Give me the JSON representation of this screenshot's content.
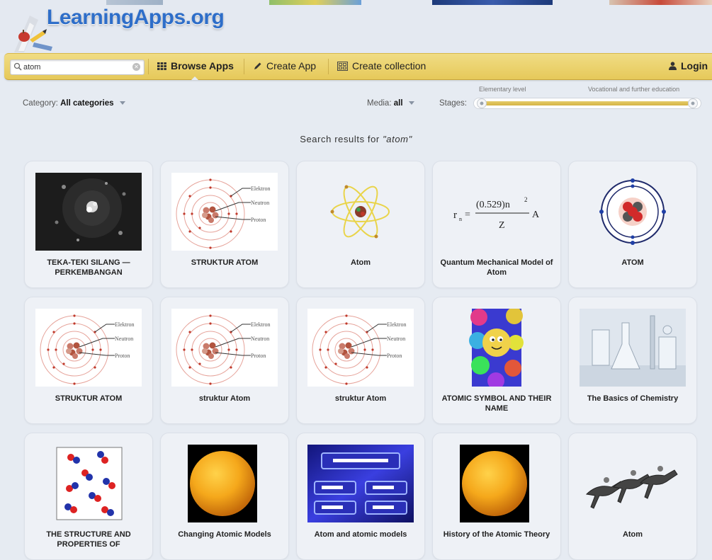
{
  "header": {
    "logo_text": "LearningApps.org"
  },
  "nav": {
    "search": {
      "value": "atom",
      "placeholder": ""
    },
    "browse_label": "Browse Apps",
    "create_app_label": "Create App",
    "create_collection_label": "Create collection",
    "login_label": "Login"
  },
  "filters": {
    "category_label": "Category:",
    "category_value": "All categories",
    "media_label": "Media:",
    "media_value": "all",
    "stages_label": "Stages:",
    "stage_left": "Elementary level",
    "stage_right": "Vocational and further education"
  },
  "results": {
    "prefix": "Search results for ",
    "query": "\"atom\"",
    "items": [
      {
        "title": "TEKA-TEKI SILANG — PERKEMBANGAN",
        "icon": "atom-photo-dark"
      },
      {
        "title": "STRUKTUR ATOM",
        "icon": "atom-structure-diagram"
      },
      {
        "title": "Atom",
        "icon": "atom-orbit-symbol"
      },
      {
        "title": "Quantum Mechanical Model of Atom",
        "icon": "bohr-radius-formula"
      },
      {
        "title": "ATOM",
        "icon": "atom-nucleus-model"
      },
      {
        "title": "STRUKTUR ATOM",
        "icon": "atom-structure-diagram"
      },
      {
        "title": "struktur Atom",
        "icon": "atom-structure-diagram"
      },
      {
        "title": "struktur Atom",
        "icon": "atom-structure-diagram"
      },
      {
        "title": "ATOMIC SYMBOL AND THEIR NAME",
        "icon": "colorful-balls-cartoon"
      },
      {
        "title": "The Basics of Chemistry",
        "icon": "lab-glassware-photo"
      },
      {
        "title": "THE STRUCTURE AND PROPERTIES OF",
        "icon": "molecules-diagram"
      },
      {
        "title": "Changing Atomic Models",
        "icon": "orange-sphere"
      },
      {
        "title": "Atom and atomic models",
        "icon": "quiz-board"
      },
      {
        "title": "History of the Atomic Theory",
        "icon": "orange-sphere"
      },
      {
        "title": "Atom",
        "icon": "horse-race-illustration"
      }
    ]
  },
  "diagram_labels": {
    "elektron": "Elektron",
    "neutron": "Neutron",
    "proton": "Proton"
  },
  "formula": {
    "lhs": "r",
    "sub": "n",
    "num": "(0.529)n",
    "sup": "2",
    "den": "Z",
    "unit": "A"
  },
  "colors": {
    "nav_bar": "#e6c95a",
    "logo": "#2e6ec9",
    "page_bg": "#e6ebf2",
    "card_bg": "#eef1f6"
  }
}
